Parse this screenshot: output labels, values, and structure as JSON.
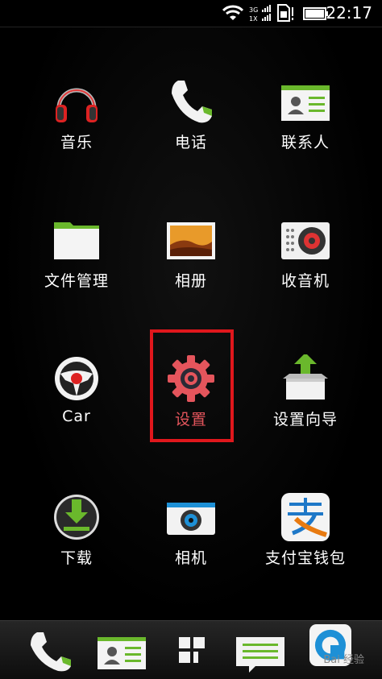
{
  "status_bar": {
    "time": "22:17",
    "network": "3G",
    "network2": "1X",
    "icons": [
      "wifi-icon",
      "signal-icon",
      "sim-icon",
      "battery-icon"
    ]
  },
  "apps": [
    {
      "label": "音乐",
      "icon": "headphones-icon"
    },
    {
      "label": "电话",
      "icon": "phone-icon"
    },
    {
      "label": "联系人",
      "icon": "contacts-card-icon"
    },
    {
      "label": "文件管理",
      "icon": "folder-icon"
    },
    {
      "label": "相册",
      "icon": "gallery-icon"
    },
    {
      "label": "收音机",
      "icon": "radio-icon"
    },
    {
      "label": "Car",
      "icon": "steering-wheel-icon"
    },
    {
      "label": "设置",
      "icon": "gear-icon",
      "selected": true
    },
    {
      "label": "设置向导",
      "icon": "setup-box-icon"
    },
    {
      "label": "下载",
      "icon": "download-icon"
    },
    {
      "label": "相机",
      "icon": "camera-icon"
    },
    {
      "label": "支付宝钱包",
      "icon": "alipay-icon"
    }
  ],
  "dock": [
    {
      "icon": "phone-icon"
    },
    {
      "icon": "contacts-card-icon"
    },
    {
      "icon": "app-grid-icon"
    },
    {
      "icon": "messages-icon"
    },
    {
      "icon": "browser-icon"
    }
  ],
  "colors": {
    "highlight": "#e0171c",
    "selected_label": "#e4555c",
    "accent_green": "#6ab82c"
  },
  "watermark": "Bai 经验"
}
